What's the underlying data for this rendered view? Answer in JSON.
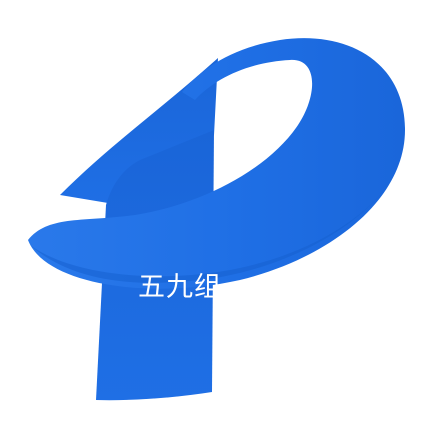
{
  "logo": {
    "icon": "blue-p-swoosh-logo-icon",
    "primary_color": "#1f6fe5",
    "shade_color": "#1762d2",
    "background_color": "#ffffff"
  },
  "overlay": {
    "text": "五九组",
    "color": "#ffffff"
  }
}
